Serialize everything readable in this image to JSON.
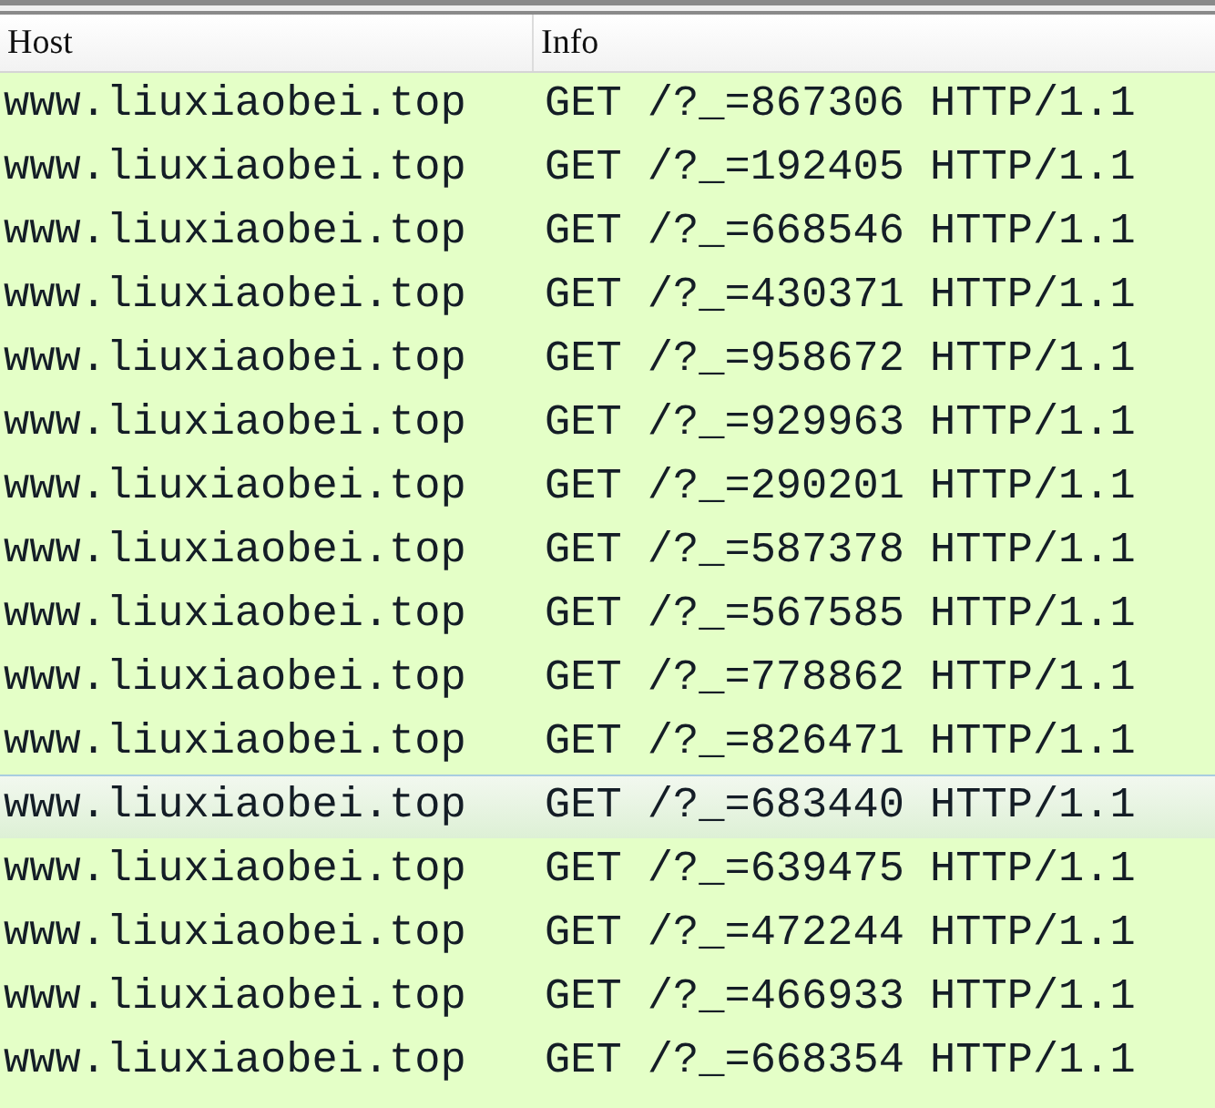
{
  "table": {
    "columns": [
      "Host",
      "Info"
    ],
    "rows": [
      {
        "host": "www.liuxiaobei.top",
        "info": "GET /?_=867306 HTTP/1.1",
        "selected": false
      },
      {
        "host": "www.liuxiaobei.top",
        "info": "GET /?_=192405 HTTP/1.1",
        "selected": false
      },
      {
        "host": "www.liuxiaobei.top",
        "info": "GET /?_=668546 HTTP/1.1",
        "selected": false
      },
      {
        "host": "www.liuxiaobei.top",
        "info": "GET /?_=430371 HTTP/1.1",
        "selected": false
      },
      {
        "host": "www.liuxiaobei.top",
        "info": "GET /?_=958672 HTTP/1.1",
        "selected": false
      },
      {
        "host": "www.liuxiaobei.top",
        "info": "GET /?_=929963 HTTP/1.1",
        "selected": false
      },
      {
        "host": "www.liuxiaobei.top",
        "info": "GET /?_=290201 HTTP/1.1",
        "selected": false
      },
      {
        "host": "www.liuxiaobei.top",
        "info": "GET /?_=587378 HTTP/1.1",
        "selected": false
      },
      {
        "host": "www.liuxiaobei.top",
        "info": "GET /?_=567585 HTTP/1.1",
        "selected": false
      },
      {
        "host": "www.liuxiaobei.top",
        "info": "GET /?_=778862 HTTP/1.1",
        "selected": false
      },
      {
        "host": "www.liuxiaobei.top",
        "info": "GET /?_=826471 HTTP/1.1",
        "selected": false
      },
      {
        "host": "www.liuxiaobei.top",
        "info": "GET /?_=683440 HTTP/1.1",
        "selected": true
      },
      {
        "host": "www.liuxiaobei.top",
        "info": "GET /?_=639475 HTTP/1.1",
        "selected": false
      },
      {
        "host": "www.liuxiaobei.top",
        "info": "GET /?_=472244 HTTP/1.1",
        "selected": false
      },
      {
        "host": "www.liuxiaobei.top",
        "info": "GET /?_=466933 HTTP/1.1",
        "selected": false
      },
      {
        "host": "www.liuxiaobei.top",
        "info": "GET /?_=668354 HTTP/1.1",
        "selected": false
      }
    ]
  }
}
